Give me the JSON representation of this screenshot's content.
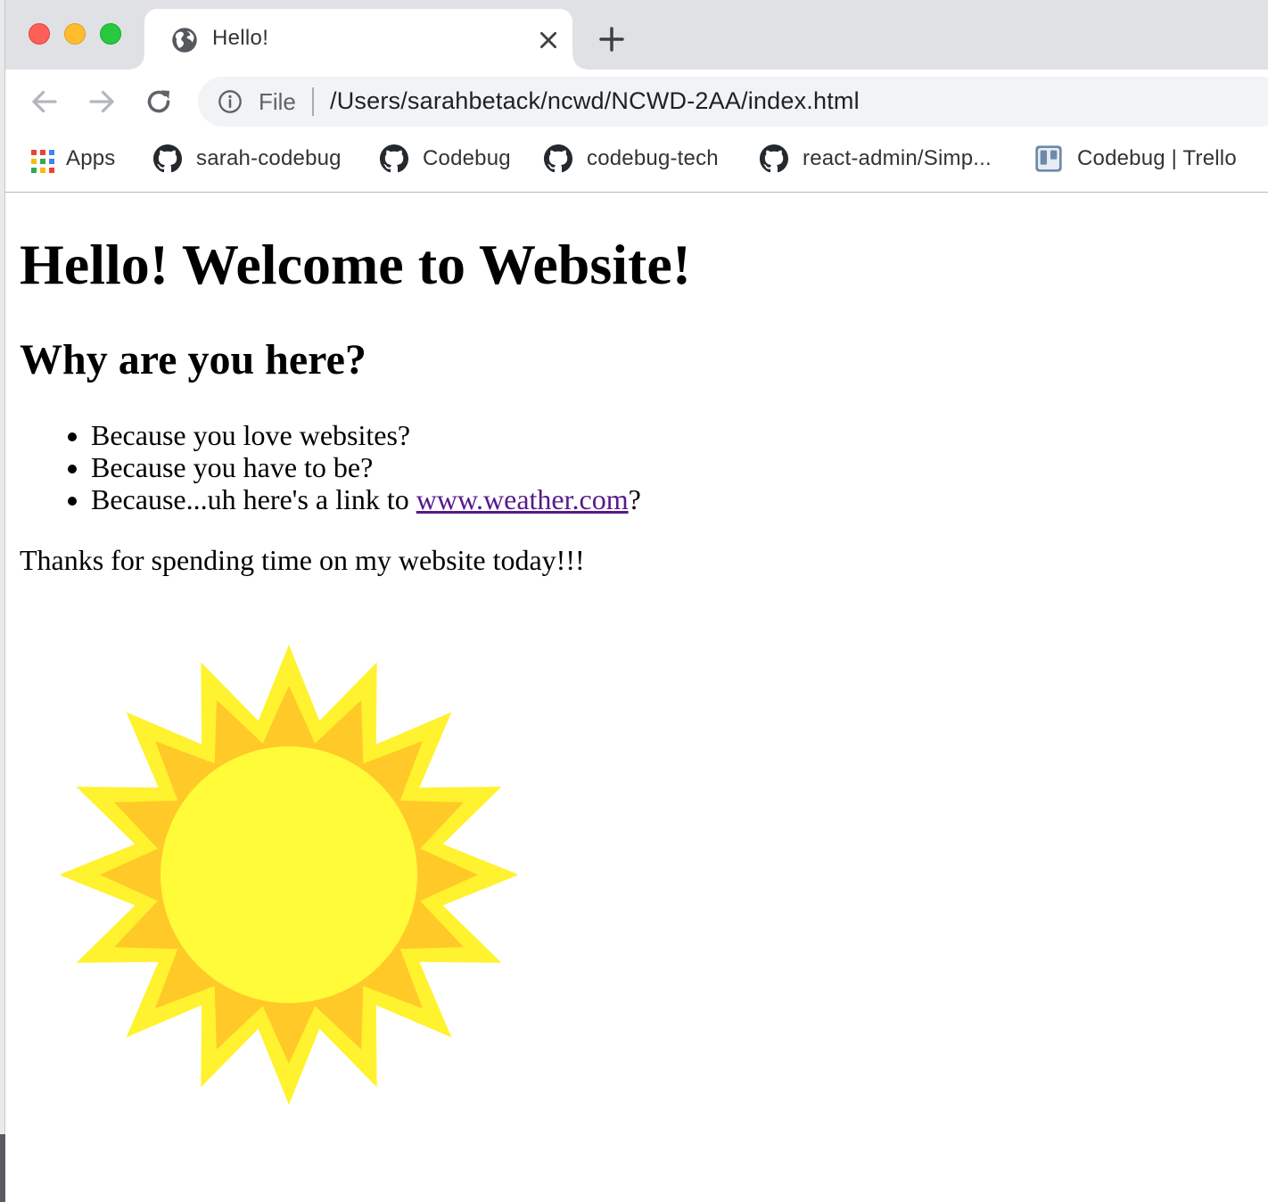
{
  "browser": {
    "tab": {
      "title": "Hello!"
    },
    "omnibox": {
      "scheme_label": "File",
      "url": "/Users/sarahbetack/ncwd/NCWD-2AA/index.html"
    },
    "bookmarks": [
      {
        "label": "Apps",
        "icon": "apps-grid-icon"
      },
      {
        "label": "sarah-codebug",
        "icon": "github-icon"
      },
      {
        "label": "Codebug",
        "icon": "github-icon"
      },
      {
        "label": "codebug-tech",
        "icon": "github-icon"
      },
      {
        "label": "react-admin/Simp...",
        "icon": "github-icon"
      },
      {
        "label": "Codebug | Trello",
        "icon": "trello-icon"
      }
    ]
  },
  "page": {
    "heading": "Hello! Welcome to Website!",
    "subheading": "Why are you here?",
    "reasons": [
      {
        "text": "Because you love websites?"
      },
      {
        "text": "Because you have to be?"
      },
      {
        "text_before": "Because...uh here's a link to ",
        "link_text": "www.weather.com",
        "text_after": "?"
      }
    ],
    "closing": "Thanks for spending time on my website today!!!",
    "image": {
      "icon": "sun-icon",
      "colors": {
        "outer_rays": "#fff22e",
        "inner_rays": "#ffc928",
        "disc": "#fffb38"
      }
    }
  }
}
